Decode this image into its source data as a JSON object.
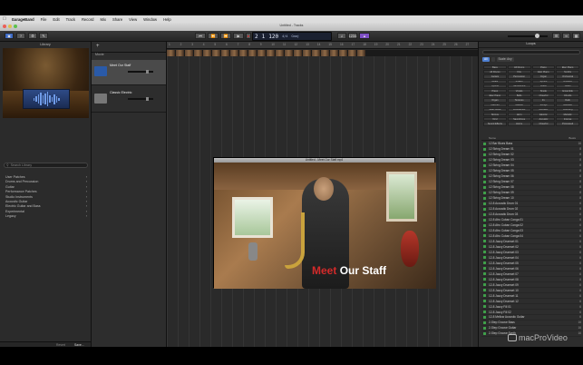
{
  "menubar": {
    "apple": "",
    "items": [
      "GarageBand",
      "File",
      "Edit",
      "Track",
      "Record",
      "Mix",
      "Share",
      "View",
      "Window",
      "Help"
    ]
  },
  "window": {
    "title": "Untitled - Tracks"
  },
  "toolbar": {
    "lcd": {
      "bar": "2",
      "beat": "1",
      "tempo": "120",
      "key": "Cmaj",
      "sig": "4/4"
    }
  },
  "library": {
    "title": "Library",
    "search_placeholder": "Search Library",
    "categories": [
      "User Patches",
      "Drums and Percussion",
      "Guitar",
      "Performance Patches",
      "Studio Instruments",
      "Acoustic Guitar",
      "Electric Guitar and Bass",
      "Experimental",
      "Legacy"
    ],
    "footer": {
      "revert": "Revert",
      "save": "Save..."
    }
  },
  "tracks": {
    "movie_label": "Movie",
    "items": [
      {
        "name": "Meet Our Staff",
        "selected": true,
        "color": "#2a5aa8"
      },
      {
        "name": "Classic Electric",
        "selected": false,
        "color": "#777777"
      }
    ]
  },
  "movie_window": {
    "title": "Untitled - Meet Our Staff.mp4",
    "caption_red": "Meet",
    "caption_white": "Our Staff"
  },
  "loops": {
    "title": "Loops",
    "tabs": [
      "All",
      "",
      "Scale: Any"
    ],
    "keywords": [
      "Bass",
      "All Drums",
      "Piano",
      "Elec Piano",
      "All Drums",
      "Kits",
      "Elec Piano",
      "Synths",
      "Guitars",
      "Percussion",
      "Organ",
      "Orchestral",
      "Beats",
      "Shaker",
      "Synths",
      "Ambient",
      "Synths",
      "Tambourine",
      "Brass",
      "Clean",
      "Piano",
      "Vocals",
      "Single",
      "Ensemble",
      "Elec Piano",
      "Bells",
      "Cheerful",
      "Chords",
      "Organ",
      "Textures",
      "Fx",
      "Dark",
      "Clavinet",
      "Mallets",
      "Strings",
      "Relaxed",
      "Slide Guitar",
      "Woodwinds",
      "Acoustic",
      "Grooving",
      "Strings",
      "Horn",
      "Electric",
      "Melodic",
      "Vinyl",
      "Saxophone",
      "Acoustic",
      "Intense",
      "Sound Effects",
      "Horns",
      "Cheerful",
      "Processed"
    ],
    "list_header": {
      "name": "Name",
      "beats": "Beats"
    },
    "items": [
      {
        "name": "12 Bar Blues Bass",
        "beats": "16"
      },
      {
        "name": "12 String Dream 01",
        "beats": "8"
      },
      {
        "name": "12 String Dream 02",
        "beats": "8"
      },
      {
        "name": "12 String Dream 03",
        "beats": "8"
      },
      {
        "name": "12 String Dream 04",
        "beats": "8"
      },
      {
        "name": "12 String Dream 05",
        "beats": "8"
      },
      {
        "name": "12 String Dream 06",
        "beats": "8"
      },
      {
        "name": "12 String Dream 07",
        "beats": "8"
      },
      {
        "name": "12 String Dream 08",
        "beats": "8"
      },
      {
        "name": "12 String Dream 09",
        "beats": "8"
      },
      {
        "name": "12 String Dream 10",
        "beats": "8"
      },
      {
        "name": "12-8 Acoustic Drum 01",
        "beats": "6"
      },
      {
        "name": "12-8 Acoustic Drum 02",
        "beats": "6"
      },
      {
        "name": "12-8 Acoustic Drum 03",
        "beats": "6"
      },
      {
        "name": "12-8 Afro Cuban Conga 01",
        "beats": "6"
      },
      {
        "name": "12-8 Afro Cuban Conga 02",
        "beats": "6"
      },
      {
        "name": "12-8 Afro Cuban Conga 03",
        "beats": "6"
      },
      {
        "name": "12-8 Afro Cuban Conga 04",
        "beats": "6"
      },
      {
        "name": "12-8 Jazzy Drumset 01",
        "beats": "6"
      },
      {
        "name": "12-8 Jazzy Drumset 02",
        "beats": "6"
      },
      {
        "name": "12-8 Jazzy Drumset 03",
        "beats": "6"
      },
      {
        "name": "12-8 Jazzy Drumset 04",
        "beats": "6"
      },
      {
        "name": "12-8 Jazzy Drumset 05",
        "beats": "6"
      },
      {
        "name": "12-8 Jazzy Drumset 06",
        "beats": "6"
      },
      {
        "name": "12-8 Jazzy Drumset 07",
        "beats": "6"
      },
      {
        "name": "12-8 Jazzy Drumset 08",
        "beats": "6"
      },
      {
        "name": "12-8 Jazzy Drumset 09",
        "beats": "6"
      },
      {
        "name": "12-8 Jazzy Drumset 10",
        "beats": "6"
      },
      {
        "name": "12-8 Jazzy Drumset 11",
        "beats": "6"
      },
      {
        "name": "12-8 Jazzy Drumset 12",
        "beats": "6"
      },
      {
        "name": "12-8 Jazzy Fill 01",
        "beats": "6"
      },
      {
        "name": "12-8 Jazzy Fill 02",
        "beats": "6"
      },
      {
        "name": "12-8 Mellow Acoustic Guitar",
        "beats": "6"
      },
      {
        "name": "2-Step Groove Bass",
        "beats": "16"
      },
      {
        "name": "2-Step Groove Guitar",
        "beats": "16"
      },
      {
        "name": "2-Step Groove Synth",
        "beats": "16"
      }
    ]
  },
  "watermark": {
    "text": "macProVideo"
  }
}
